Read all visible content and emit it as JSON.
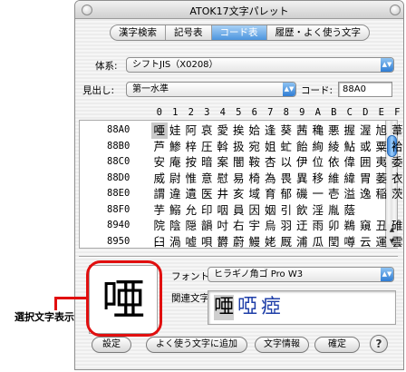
{
  "window": {
    "title": "ATOK17文字パレット"
  },
  "tabs": [
    {
      "label": "漢字検索",
      "active": false
    },
    {
      "label": "記号表",
      "active": false
    },
    {
      "label": "コード表",
      "active": true
    },
    {
      "label": "履歴・よく使う文字",
      "active": false
    }
  ],
  "system": {
    "label": "体系:",
    "value": "シフトJIS（X0208）"
  },
  "heading": {
    "label": "見出し:",
    "value": "第一水準"
  },
  "code": {
    "label": "コード:",
    "value": "88A0"
  },
  "grid": {
    "col_headers": [
      "0",
      "1",
      "2",
      "3",
      "4",
      "5",
      "6",
      "7",
      "8",
      "9",
      "A",
      "B",
      "C",
      "D",
      "E",
      "F"
    ],
    "rows": [
      {
        "code": "88A0",
        "chars": [
          "唖",
          "娃",
          "阿",
          "哀",
          "愛",
          "挨",
          "姶",
          "逢",
          "葵",
          "茜",
          "穐",
          "悪",
          "握",
          "渥",
          "旭",
          "葦"
        ]
      },
      {
        "code": "88B0",
        "chars": [
          "芦",
          "鯵",
          "梓",
          "圧",
          "斡",
          "扱",
          "宛",
          "姐",
          "虻",
          "飴",
          "絢",
          "綾",
          "鮎",
          "或",
          "粟",
          "袷"
        ]
      },
      {
        "code": "88C0",
        "chars": [
          "安",
          "庵",
          "按",
          "暗",
          "案",
          "闇",
          "鞍",
          "杏",
          "以",
          "伊",
          "位",
          "依",
          "偉",
          "囲",
          "夷",
          "委"
        ]
      },
      {
        "code": "88D0",
        "chars": [
          "威",
          "尉",
          "惟",
          "意",
          "慰",
          "易",
          "椅",
          "為",
          "畏",
          "異",
          "移",
          "維",
          "緯",
          "胃",
          "萎",
          "衣"
        ]
      },
      {
        "code": "88E0",
        "chars": [
          "謂",
          "違",
          "遺",
          "医",
          "井",
          "亥",
          "域",
          "育",
          "郁",
          "磯",
          "一",
          "壱",
          "溢",
          "逸",
          "稲",
          "茨"
        ]
      },
      {
        "code": "88F0",
        "chars": [
          "芋",
          "鰯",
          "允",
          "印",
          "咽",
          "員",
          "因",
          "姻",
          "引",
          "飲",
          "淫",
          "胤",
          "蔭",
          "",
          "",
          ""
        ]
      },
      {
        "code": "8940",
        "chars": [
          "院",
          "陰",
          "隠",
          "韻",
          "吋",
          "右",
          "宇",
          "烏",
          "羽",
          "迂",
          "雨",
          "卯",
          "鵜",
          "窺",
          "丑",
          "碓"
        ]
      },
      {
        "code": "8950",
        "chars": [
          "臼",
          "渦",
          "嘘",
          "唄",
          "欝",
          "蔚",
          "鰻",
          "姥",
          "厩",
          "浦",
          "瓜",
          "閏",
          "噂",
          "云",
          "運",
          "雲"
        ]
      }
    ],
    "selected": "唖"
  },
  "font": {
    "label": "フォント:",
    "value": "ヒラギノ角ゴ Pro W3"
  },
  "related": {
    "label": "関連文字:",
    "chars": [
      "唖",
      "啞",
      "瘂"
    ]
  },
  "preview": {
    "char": "唖"
  },
  "buttons": {
    "settings": "設定",
    "add_favorite": "よく使う文字に追加",
    "char_info": "文字情報",
    "ok": "確定",
    "help": "?"
  },
  "callout": {
    "text": "選択文字表示"
  },
  "colors": {
    "accent": "#3b86d8",
    "callout": "#e10f0f",
    "related_blue": "#1f3fa8"
  }
}
